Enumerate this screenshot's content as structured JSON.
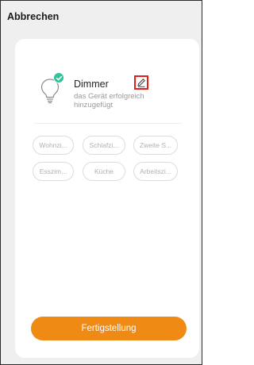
{
  "header": {
    "cancel_label": "Abbrechen"
  },
  "device": {
    "name": "Dimmer",
    "status": "das Gerät erfolgreich hinzugefügt",
    "icon": "bulb-icon",
    "status_icon": "check-icon",
    "edit_icon": "pencil-icon"
  },
  "rooms": [
    {
      "label": "Wohnzi..."
    },
    {
      "label": "Schlafzi..."
    },
    {
      "label": "Zweite S..."
    },
    {
      "label": "Esszim..."
    },
    {
      "label": "Küche"
    },
    {
      "label": "Arbeitszi..."
    }
  ],
  "footer": {
    "finish_label": "Fertigstellung"
  },
  "colors": {
    "accent": "#ef8a14",
    "success": "#2fc29b",
    "highlight": "#e0201c"
  }
}
